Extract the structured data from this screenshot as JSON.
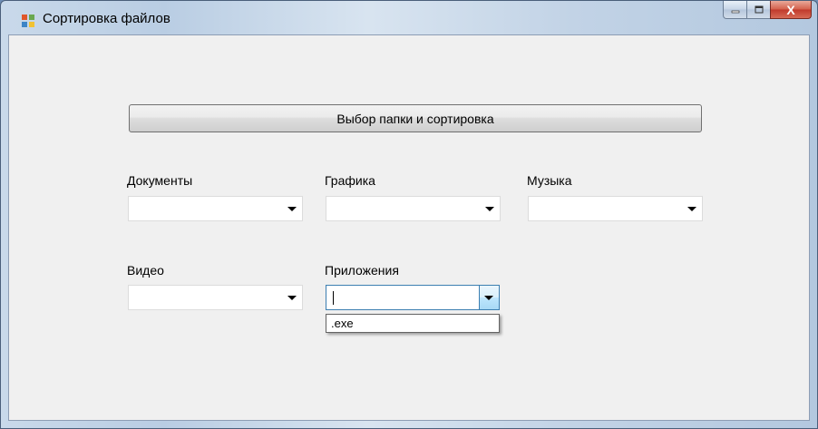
{
  "window": {
    "title": "Сортировка файлов",
    "icon": "windows-form-icon",
    "caption_buttons": {
      "minimize_icon": "minimize-icon",
      "maximize_icon": "maximize-icon",
      "close_icon": "close-icon",
      "close_glyph": "X"
    }
  },
  "main_button": {
    "label": "Выбор папки и сортировка"
  },
  "categories": {
    "documents": {
      "label": "Документы",
      "value": ""
    },
    "graphics": {
      "label": "Графика",
      "value": ""
    },
    "music": {
      "label": "Музыка",
      "value": ""
    },
    "video": {
      "label": "Видео",
      "value": ""
    },
    "applications": {
      "label": "Приложения",
      "value": "",
      "options": [
        ".exe"
      ]
    }
  },
  "colors": {
    "client_background": "#f0f0f0",
    "focus_border": "#3c7fb1",
    "close_button": "#c0392b"
  }
}
